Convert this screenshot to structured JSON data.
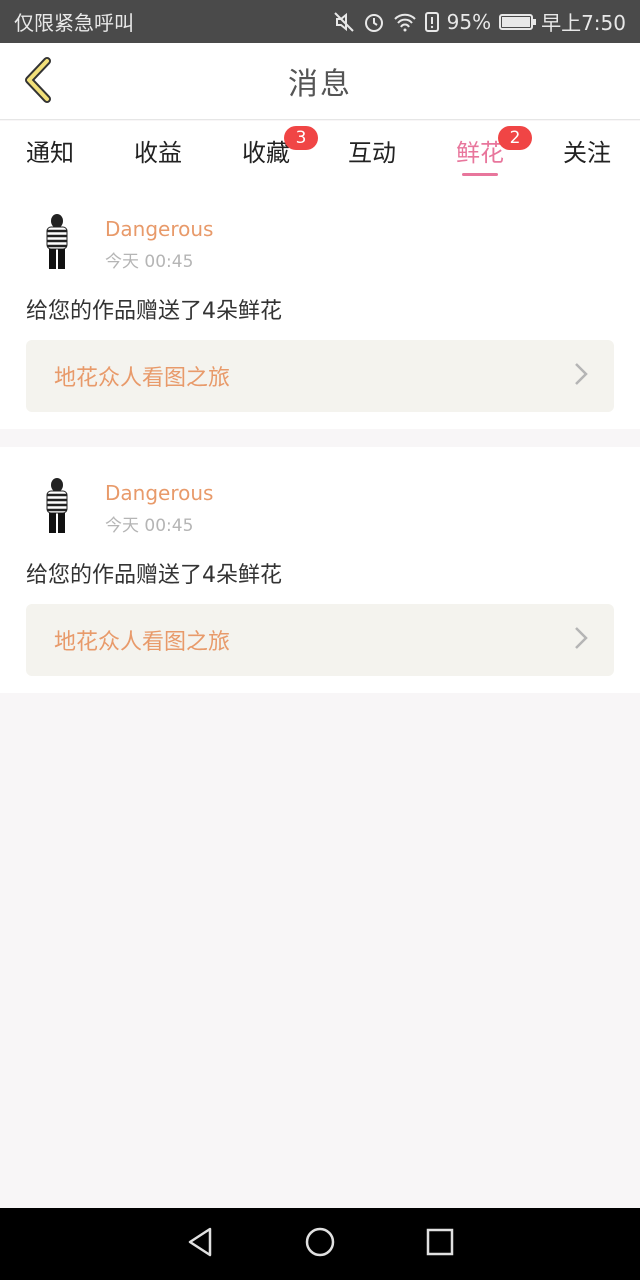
{
  "status_bar": {
    "carrier": "仅限紧急呼叫",
    "battery_percent": "95%",
    "time": "早上7:50",
    "icons": [
      "mute-icon",
      "alarm-icon",
      "wifi-icon",
      "sim-alert-icon",
      "battery-icon"
    ]
  },
  "header": {
    "title": "消息",
    "back_icon": "chevron-left-icon"
  },
  "tabs": [
    {
      "label": "通知",
      "badge": ""
    },
    {
      "label": "收益",
      "badge": ""
    },
    {
      "label": "收藏",
      "badge": "3"
    },
    {
      "label": "互动",
      "badge": ""
    },
    {
      "label": "鲜花",
      "badge": "2",
      "active": true
    },
    {
      "label": "关注",
      "badge": ""
    }
  ],
  "messages": [
    {
      "username": "Dangerous",
      "time": "今天 00:45",
      "text": "给您的作品赠送了4朵鲜花",
      "work_title": "地花众人看图之旅"
    },
    {
      "username": "Dangerous",
      "time": "今天 00:45",
      "text": "给您的作品赠送了4朵鲜花",
      "work_title": "地花众人看图之旅"
    }
  ],
  "nav_bar": {
    "icons": [
      "back-triangle-icon",
      "home-circle-icon",
      "recents-square-icon"
    ]
  },
  "colors": {
    "accent_pink": "#e8769c",
    "username_orange": "#e89a6a",
    "badge_red": "#f04545"
  }
}
